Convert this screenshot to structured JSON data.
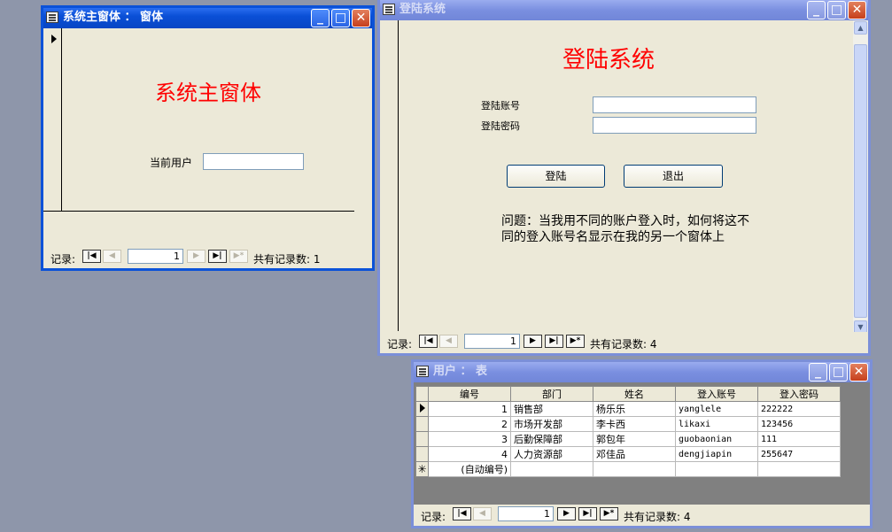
{
  "main_form": {
    "title": "系统主窗体 ： 窗体",
    "heading": "系统主窗体",
    "current_user_label": "当前用户",
    "current_user_value": "",
    "nav": {
      "record_label": "记录:",
      "record_no": "1",
      "total_label": "共有记录数: 1"
    }
  },
  "login_form": {
    "title": "登陆系统",
    "heading": "登陆系统",
    "account_label": "登陆账号",
    "account_value": "",
    "password_label": "登陆密码",
    "password_value": "",
    "login_button": "登陆",
    "exit_button": "退出",
    "question": "问题：当我用不同的账户登入时，如何将这不同的登入账号名显示在我的另一个窗体上",
    "nav": {
      "record_label": "记录:",
      "record_no": "1",
      "total_label": "共有记录数: 4"
    }
  },
  "user_table": {
    "title": "用户 ： 表",
    "columns": [
      "编号",
      "部门",
      "姓名",
      "登入账号",
      "登入密码"
    ],
    "rows": [
      [
        "1",
        "销售部",
        "杨乐乐",
        "yanglele",
        "222222"
      ],
      [
        "2",
        "市场开发部",
        "李卡西",
        "likaxi",
        "123456"
      ],
      [
        "3",
        "后勤保障部",
        "郭包年",
        "guobaonian",
        "111"
      ],
      [
        "4",
        "人力资源部",
        "邓佳品",
        "dengjiapin",
        "255647"
      ]
    ],
    "new_row_placeholder": "(自动编号)",
    "nav": {
      "record_label": "记录:",
      "record_no": "1",
      "total_label": "共有记录数: 4"
    }
  },
  "window_controls": {
    "minimize": "_",
    "maximize": "□",
    "close": "✕"
  }
}
